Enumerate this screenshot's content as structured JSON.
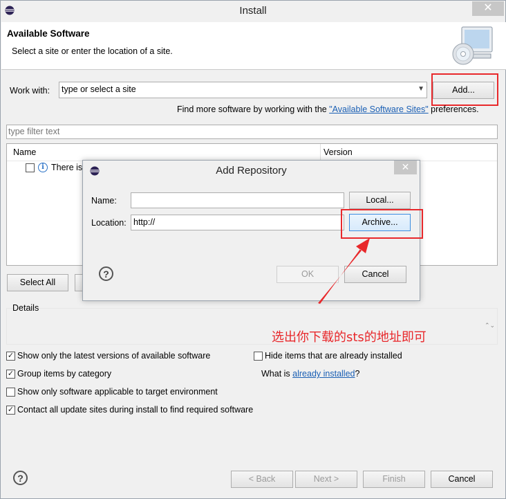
{
  "window": {
    "title": "Install",
    "close_glyph": "✕"
  },
  "banner": {
    "title": "Available Software",
    "description": "Select a site or enter the location of a site."
  },
  "work_with": {
    "label": "Work with:",
    "value": "type or select a site",
    "add_button": "Add...",
    "find_more_prefix": "Find more software by working with the ",
    "find_more_link": "\"Available Software Sites\"",
    "find_more_suffix": " preferences."
  },
  "filter": {
    "placeholder": "type filter text"
  },
  "table": {
    "columns": [
      "Name",
      "Version"
    ],
    "rows": [
      {
        "text": "There is"
      }
    ]
  },
  "buttons": {
    "select_all": "Select All"
  },
  "details": {
    "label": "Details"
  },
  "options": {
    "latest": {
      "label": "Show only the latest versions of available software",
      "checked": true
    },
    "group": {
      "label": "Group items by category",
      "checked": true
    },
    "target": {
      "label": "Show only software applicable to target environment",
      "checked": false
    },
    "contact": {
      "label": "Contact all update sites during install to find required software",
      "checked": true
    },
    "hide_installed": {
      "label": "Hide items that are already installed",
      "checked": false
    },
    "what_is_prefix": "What is ",
    "what_is_link": "already installed",
    "what_is_suffix": "?"
  },
  "footer": {
    "back": "< Back",
    "next": "Next >",
    "finish": "Finish",
    "cancel": "Cancel"
  },
  "dialog": {
    "title": "Add Repository",
    "close_glyph": "✕",
    "name_label": "Name:",
    "name_value": "",
    "location_label": "Location:",
    "location_value": "http://",
    "local_button": "Local...",
    "archive_button": "Archive...",
    "ok_button": "OK",
    "cancel_button": "Cancel"
  },
  "annotation": {
    "text": "选出你下载的sts的地址即可",
    "color": "#e8282b"
  },
  "icons": {
    "app": "eclipse-icon",
    "banner": "install-cd-icon",
    "help": "help-icon",
    "info": "info-icon",
    "check": "✓",
    "help_glyph": "?",
    "info_glyph": "i",
    "dropdown_glyph": "▼",
    "scroll_glyph": "⌃⌄"
  }
}
